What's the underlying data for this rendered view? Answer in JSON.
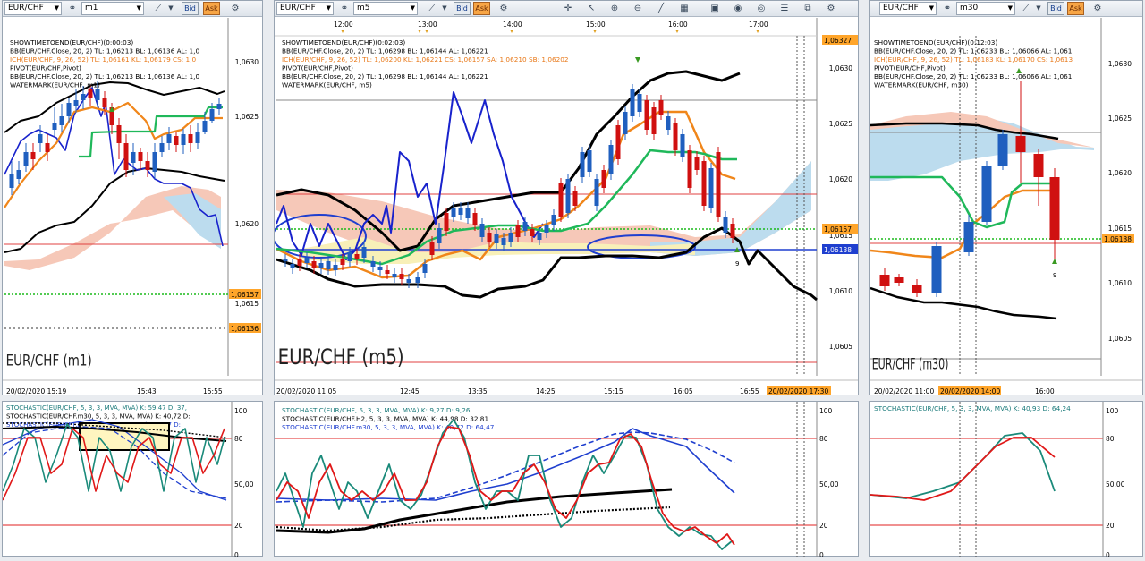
{
  "window_left": {
    "symbol": "EUR/CHF",
    "timeframe": "m1",
    "bid_label": "Bid",
    "ask_label": "Ask",
    "legend": [
      {
        "text": "SHOWTIMETOEND(EUR/CHF)(0:00:03)",
        "color": "#000000"
      },
      {
        "text": "BB(EUR/CHF.Close, 20, 2)  TL: 1,06213  BL: 1,06136  AL: 1,0",
        "color": "#000000"
      },
      {
        "text": "ICH(EUR/CHF, 9, 26, 52)  TL: 1,06161  KL: 1,06179  CS: 1,0",
        "color": "#e8791a"
      },
      {
        "text": "PIVOT(EUR/CHF,Pivot)",
        "color": "#000000"
      },
      {
        "text": "BB(EUR/CHF.Close, 20, 2)  TL: 1,06213  BL: 1,06136  AL: 1,0",
        "color": "#000000"
      },
      {
        "text": "WATERMARK(EUR/CHF, m1)",
        "color": "#000000"
      }
    ],
    "watermark": "EUR/CHF (m1)",
    "price_labels": [
      "1,0630",
      "1,0625",
      "1,0620",
      "1,0615"
    ],
    "price_tag_green": "1,06157",
    "price_tag_orange": "1,06136",
    "time_labels": [
      "20/02/2020 15:19",
      "15:43",
      "15:55"
    ],
    "osc_legend": [
      {
        "text": "STOCHASTIC(EUR/CHF, 5, 3, 3, MVA, MVA)  K: 59,47  D: 37,",
        "color": "#1a7a7a"
      },
      {
        "text": "STOCHASTIC(EUR/CHF.m30, 5, 3, 3, MVA, MVA)  K: 40,72  D:",
        "color": "#000000"
      },
      {
        "text": "STOCHASTIC(EUR/CHF.H5, 5, 3, 3, MVA, MVA)  K: 9,27  D:",
        "color": "#1f3fcf"
      }
    ],
    "osc_levels": [
      "100",
      "80",
      "50,00",
      "20",
      "0"
    ]
  },
  "window_mid": {
    "symbol": "EUR/CHF",
    "timeframe": "m5",
    "bid_label": "Bid",
    "ask_label": "Ask",
    "top_times": [
      "12:00",
      "13:00",
      "14:00",
      "15:00",
      "16:00",
      "17:00"
    ],
    "legend": [
      {
        "text": "SHOWTIMETOEND(EUR/CHF)(0:02:03)",
        "color": "#000000"
      },
      {
        "text": "BB(EUR/CHF.Close, 20, 2)  TL: 1,06298  BL: 1,06144  AL: 1,06221",
        "color": "#000000"
      },
      {
        "text": "ICH(EUR/CHF, 9, 26, 52)  TL: 1,06200  KL: 1,06221  CS: 1,06157  SA: 1,06210  SB: 1,06202",
        "color": "#e8791a"
      },
      {
        "text": "PIVOT(EUR/CHF,Pivot)",
        "color": "#000000"
      },
      {
        "text": "BB(EUR/CHF.Close, 20, 2)  TL: 1,06298  BL: 1,06144  AL: 1,06221",
        "color": "#000000"
      },
      {
        "text": "WATERMARK(EUR/CHF, m5)",
        "color": "#000000"
      }
    ],
    "watermark": "EUR/CHF (m5)",
    "price_labels": [
      "1,0630",
      "1,0625",
      "1,0620",
      "1,0615",
      "1,0610",
      "1,0605"
    ],
    "price_tag_top": "1,06327",
    "price_tag_green": "1,06157",
    "price_tag_blue": "1,06138",
    "arrow_count": "9",
    "time_labels": [
      "20/02/2020 11:05",
      "12:45",
      "13:35",
      "14:25",
      "15:15",
      "16:05",
      "16:55"
    ],
    "time_tag": "20/02/2020 17:30",
    "osc_legend": [
      {
        "text": "STOCHASTIC(EUR/CHF, 5, 3, 3, MVA, MVA)  K: 9,27  D: 9,26",
        "color": "#1a7a7a"
      },
      {
        "text": "STOCHASTIC(EUR/CHF.H2, 5, 3, 3, MVA, MVA)  K: 44,98  D: 32,81",
        "color": "#000000"
      },
      {
        "text": "STOCHASTIC(EUR/CHF.m30, 5, 3, 3, MVA, MVA)  K: 40,72  D: 64,47",
        "color": "#1f3fcf"
      }
    ],
    "osc_levels": [
      "100",
      "80",
      "50,00",
      "20",
      "0"
    ]
  },
  "window_right": {
    "symbol": "EUR/CHF",
    "timeframe": "m30",
    "bid_label": "Bid",
    "ask_label": "Ask",
    "legend": [
      {
        "text": "SHOWTIMETOEND(EUR/CHF)(0:12:03)",
        "color": "#000000"
      },
      {
        "text": "BB(EUR/CHF.Close, 20, 2)  TL: 1,06233  BL: 1,06066  AL: 1,061",
        "color": "#000000"
      },
      {
        "text": "ICH(EUR/CHF, 9, 26, 52)  TL: 1,06183  KL: 1,06170  CS: 1,0613",
        "color": "#e8791a"
      },
      {
        "text": "PIVOT(EUR/CHF,Pivot)",
        "color": "#000000"
      },
      {
        "text": "BB(EUR/CHF.Close, 20, 2)  TL: 1,06233  BL: 1,06066  AL: 1,061",
        "color": "#000000"
      },
      {
        "text": "WATERMARK(EUR/CHF, m30)",
        "color": "#000000"
      }
    ],
    "watermark": "EUR/CHF (m30)",
    "price_labels": [
      "1,0630",
      "1,0625",
      "1,0620",
      "1,0615",
      "1,0610",
      "1,0605"
    ],
    "price_tag_green": "1,06138",
    "arrow_count": "9",
    "time_labels": [
      "20/02/2020 11:00",
      "16:00"
    ],
    "time_tag": "20/02/2020 14:00",
    "osc_legend": [
      {
        "text": "STOCHASTIC(EUR/CHF, 5, 3, 3, MVA, MVA)  K: 40,93  D: 64,24",
        "color": "#1a7a7a"
      }
    ],
    "osc_levels": [
      "100",
      "80",
      "50,00",
      "20",
      "0"
    ]
  },
  "colors": {
    "up_candle": "#1f5fbf",
    "down_candle": "#d01010",
    "tenkan": "#f0861a",
    "kijun": "#1fb85a",
    "bollinger": "#000000",
    "stoch_k": "#1a8a7a",
    "stoch_d": "#e01818",
    "green_tag": "#22cc22",
    "orange_tag": "#f0a040",
    "blue_tag": "#1f3fcf"
  }
}
